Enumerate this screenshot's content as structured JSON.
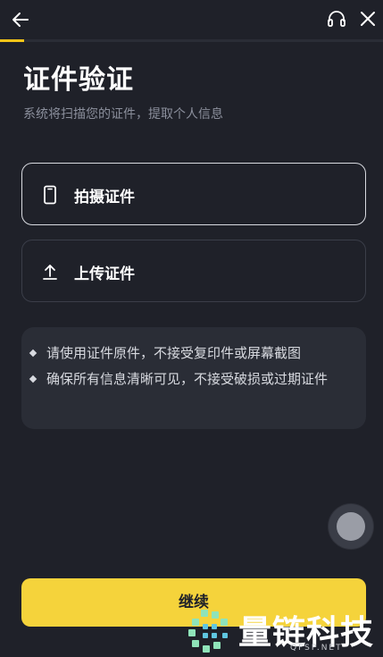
{
  "header": {
    "back_icon": "arrow-left-icon",
    "support_icon": "headset-icon",
    "close_icon": "close-icon",
    "progress": 0.063,
    "progress_color": "#f5c518"
  },
  "page": {
    "title": "证件验证",
    "subtitle": "系统将扫描您的证件，提取个人信息"
  },
  "options": [
    {
      "label": "拍摄证件",
      "icon": "phone-icon",
      "selected": true
    },
    {
      "label": "上传证件",
      "icon": "upload-icon",
      "selected": false
    }
  ],
  "tips": [
    "请使用证件原件，不接受复印件或屏幕截图",
    "确保所有信息清晰可见，不接受破损或过期证件"
  ],
  "footer": {
    "continue_label": "继续",
    "accent_color": "#f5d33b"
  },
  "watermark": {
    "brand": "量链科技",
    "domain": "QFSP.NET"
  }
}
